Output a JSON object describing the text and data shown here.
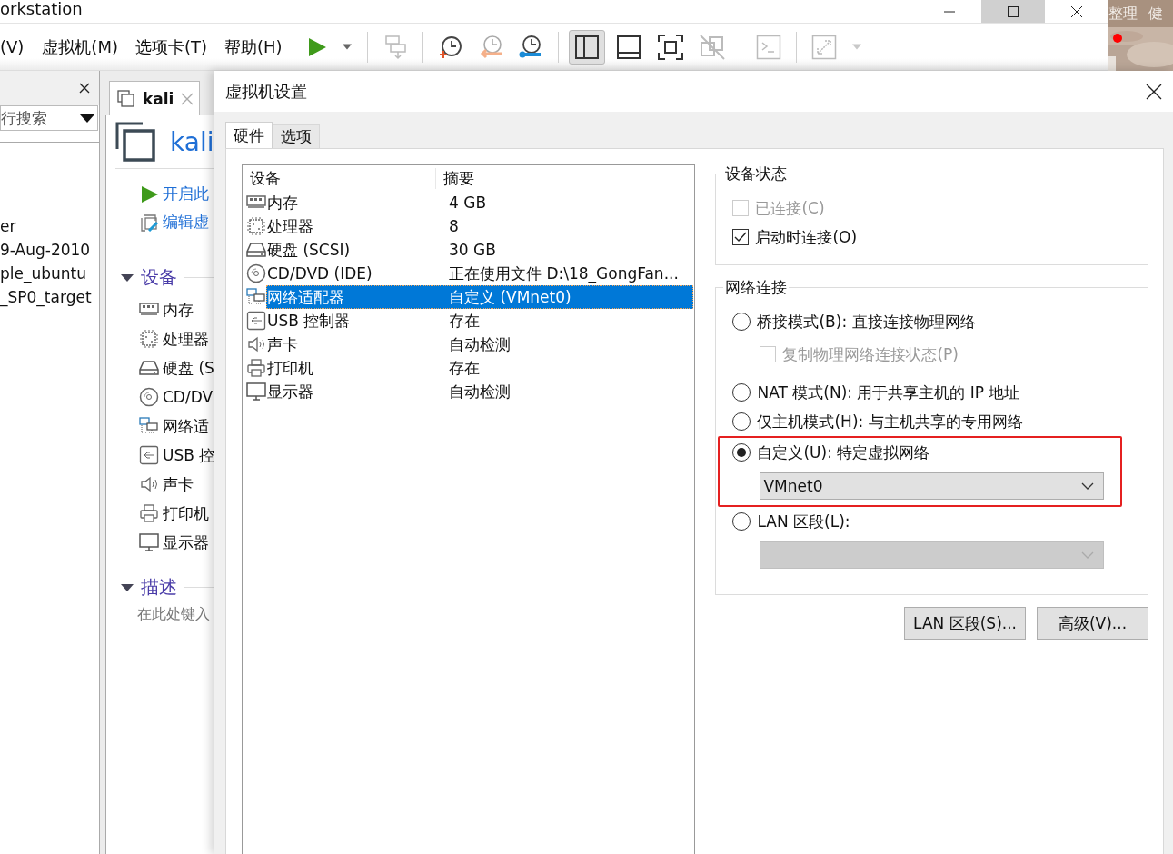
{
  "app_title": "orkstation",
  "desktop_labels": [
    "整理",
    "健"
  ],
  "menu": [
    "(V)",
    "虚拟机(M)",
    "选项卡(T)",
    "帮助(H)"
  ],
  "toolbar": [
    {
      "kind": "play",
      "disabled": false
    },
    {
      "kind": "caret",
      "disabled": false
    },
    {
      "kind": "sep"
    },
    {
      "kind": "send",
      "disabled": true
    },
    {
      "kind": "sep"
    },
    {
      "kind": "snapshot",
      "disabled": false
    },
    {
      "kind": "revert",
      "disabled": true
    },
    {
      "kind": "manage",
      "disabled": false
    },
    {
      "kind": "sep"
    },
    {
      "kind": "library_view",
      "disabled": false,
      "selected": true
    },
    {
      "kind": "console_view",
      "disabled": false,
      "selected": false
    },
    {
      "kind": "fullscreen",
      "disabled": false,
      "selected": false
    },
    {
      "kind": "unity",
      "disabled": true,
      "selected": false
    },
    {
      "kind": "sep"
    },
    {
      "kind": "terminal",
      "disabled": true
    },
    {
      "kind": "sep"
    },
    {
      "kind": "stretch",
      "disabled": true
    },
    {
      "kind": "caret",
      "disabled": true
    }
  ],
  "library": {
    "search_placeholder": "行搜索",
    "items": [
      "er",
      "9-Aug-2010",
      "ple_ubuntu",
      "_SP0_target"
    ]
  },
  "vm_tab": {
    "label": "kali",
    "selected": true
  },
  "vm_summary": {
    "title": "kali",
    "actions": [
      {
        "kind": "power_on",
        "label": "开启此"
      },
      {
        "kind": "edit",
        "label": "编辑虚"
      }
    ],
    "devices_heading": "设备",
    "devices": [
      {
        "kind": "memory",
        "label": "内存"
      },
      {
        "kind": "cpu",
        "label": "处理器"
      },
      {
        "kind": "disk",
        "label": "硬盘 (S"
      },
      {
        "kind": "cd",
        "label": "CD/DV"
      },
      {
        "kind": "network",
        "label": "网络适"
      },
      {
        "kind": "usb",
        "label": "USB 控"
      },
      {
        "kind": "sound",
        "label": "声卡"
      },
      {
        "kind": "printer",
        "label": "打印机"
      },
      {
        "kind": "display",
        "label": "显示器"
      }
    ],
    "description_heading": "描述",
    "description_placeholder": "在此处键入"
  },
  "dialog": {
    "title": "虚拟机设置",
    "tabs": [
      {
        "label": "硬件",
        "selected": true
      },
      {
        "label": "选项",
        "selected": false
      }
    ],
    "table": {
      "columns": [
        "设备",
        "摘要"
      ],
      "rows": [
        {
          "kind": "memory",
          "device": "内存",
          "summary": "4 GB",
          "selected": false
        },
        {
          "kind": "cpu",
          "device": "处理器",
          "summary": "8",
          "selected": false
        },
        {
          "kind": "disk",
          "device": "硬盘 (SCSI)",
          "summary": "30 GB",
          "selected": false
        },
        {
          "kind": "cd",
          "device": "CD/DVD (IDE)",
          "summary": "正在使用文件 D:\\18_GongFan...",
          "selected": false
        },
        {
          "kind": "network",
          "device": "网络适配器",
          "summary": "自定义 (VMnet0)",
          "selected": true
        },
        {
          "kind": "usb",
          "device": "USB 控制器",
          "summary": "存在",
          "selected": false
        },
        {
          "kind": "sound",
          "device": "声卡",
          "summary": "自动检测",
          "selected": false
        },
        {
          "kind": "printer",
          "device": "打印机",
          "summary": "存在",
          "selected": false
        },
        {
          "kind": "display",
          "device": "显示器",
          "summary": "自动检测",
          "selected": false
        }
      ]
    },
    "device_status": {
      "title": "设备状态",
      "options": [
        {
          "label": "已连接(C)",
          "checked": false,
          "disabled": true
        },
        {
          "label": "启动时连接(O)",
          "checked": true,
          "disabled": false
        }
      ]
    },
    "network": {
      "title": "网络连接",
      "options": [
        {
          "kind": "radio",
          "label": "桥接模式(B): 直接连接物理网络",
          "selected": false,
          "highlighted": false
        },
        {
          "kind": "checkbox",
          "label": "复制物理网络连接状态(P)",
          "checked": false,
          "disabled": true,
          "highlighted": false
        },
        {
          "kind": "radio",
          "label": "NAT 模式(N): 用于共享主机的 IP 地址",
          "selected": false,
          "highlighted": false
        },
        {
          "kind": "radio",
          "label": "仅主机模式(H): 与主机共享的专用网络",
          "selected": false,
          "highlighted": false
        },
        {
          "kind": "radio",
          "label": "自定义(U): 特定虚拟网络",
          "selected": true,
          "highlighted": true
        },
        {
          "kind": "dropdown",
          "value": "VMnet0",
          "disabled": false,
          "highlighted": true
        },
        {
          "kind": "radio",
          "label": "LAN 区段(L):",
          "selected": false,
          "highlighted": false
        },
        {
          "kind": "dropdown",
          "disabled": true,
          "highlighted": false
        }
      ]
    },
    "buttons": [
      "LAN 区段(S)...",
      "高级(V)..."
    ]
  }
}
